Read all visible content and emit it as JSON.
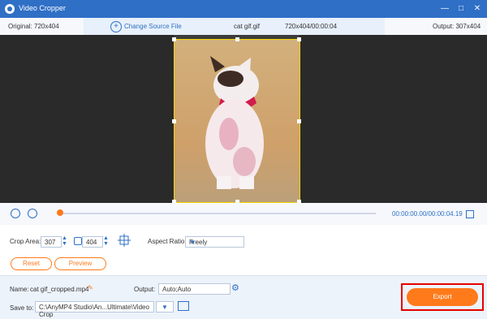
{
  "window": {
    "title": "Video Cropper",
    "icons": {
      "app": "app-icon",
      "minimize": "minimize-icon",
      "maximize": "maximize-icon",
      "close": "close-icon"
    }
  },
  "info_bar": {
    "original": "Original: 720x404",
    "change_source": "Change Source File",
    "file_name": "cat gif.gif",
    "source_info": "720x404/00:00:04",
    "output": "Output: 307x404"
  },
  "player": {
    "time_display": "00:00:00.00/00:00:04.19",
    "progress": 0.0
  },
  "crop": {
    "crop_area_label": "Crop Area:",
    "width": "307",
    "height": "404",
    "aspect_ratio_label": "Aspect Ratio:",
    "aspect_ratio_value": "Freely",
    "reset": "Reset",
    "preview": "Preview"
  },
  "footer": {
    "name_label": "Name:",
    "name_value": "cat gif_cropped.mp4",
    "output_label": "Output:",
    "output_value": "Auto;Auto",
    "save_to_label": "Save to:",
    "save_to_path": "C:\\AnyMP4 Studio\\An...Ultimate\\Video Crop",
    "export": "Export"
  },
  "colors": {
    "accent": "#2f6fc6",
    "orange": "#ff7a1a",
    "highlight": "#e60000"
  }
}
